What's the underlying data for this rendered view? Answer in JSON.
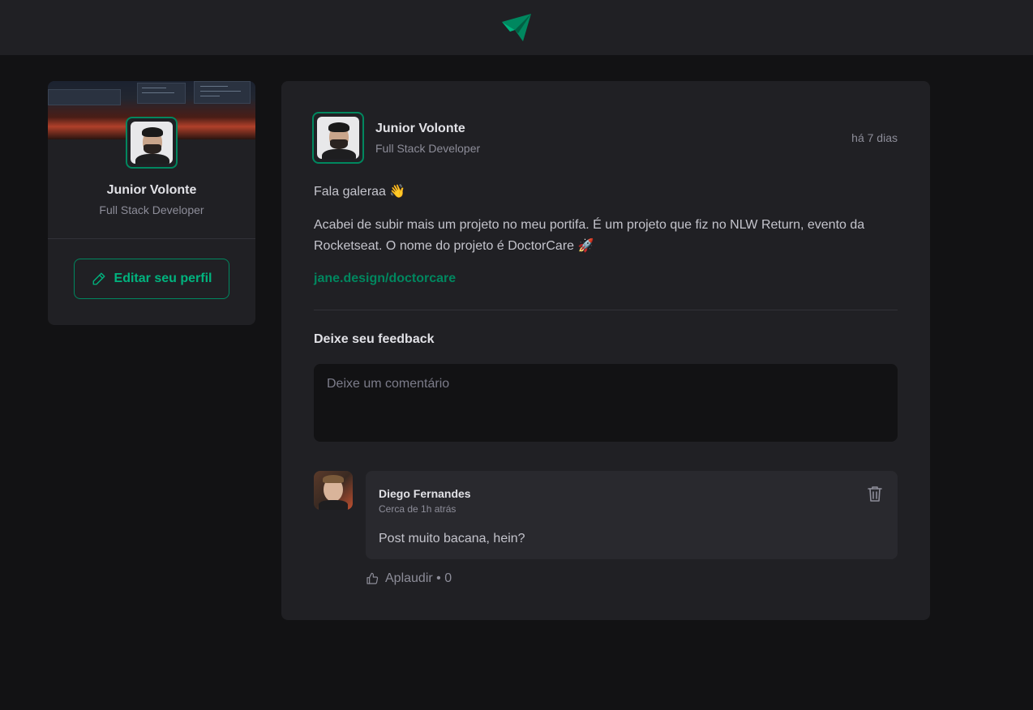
{
  "sidebar": {
    "name": "Junior Volonte",
    "role": "Full Stack Developer",
    "edit_label": "Editar seu perfil"
  },
  "post": {
    "author": {
      "name": "Junior Volonte",
      "role": "Full Stack Developer"
    },
    "time": "há 7 dias",
    "greeting": "Fala galeraa 👋",
    "body": "Acabei de subir mais um projeto no meu portifa. É um projeto que fiz no NLW Return, evento da Rocketseat. O nome do projeto é DoctorCare 🚀",
    "link": "jane.design/doctorcare"
  },
  "feedback": {
    "title": "Deixe seu feedback",
    "placeholder": "Deixe um comentário"
  },
  "comment": {
    "author": "Diego Fernandes",
    "time": "Cerca de 1h atrás",
    "text": "Post muito bacana, hein?",
    "applaud_label": "Aplaudir • 0"
  },
  "colors": {
    "brand_green": "#00875f",
    "brand_green_light": "#00b37e",
    "bg": "#121214",
    "card": "#202024"
  }
}
